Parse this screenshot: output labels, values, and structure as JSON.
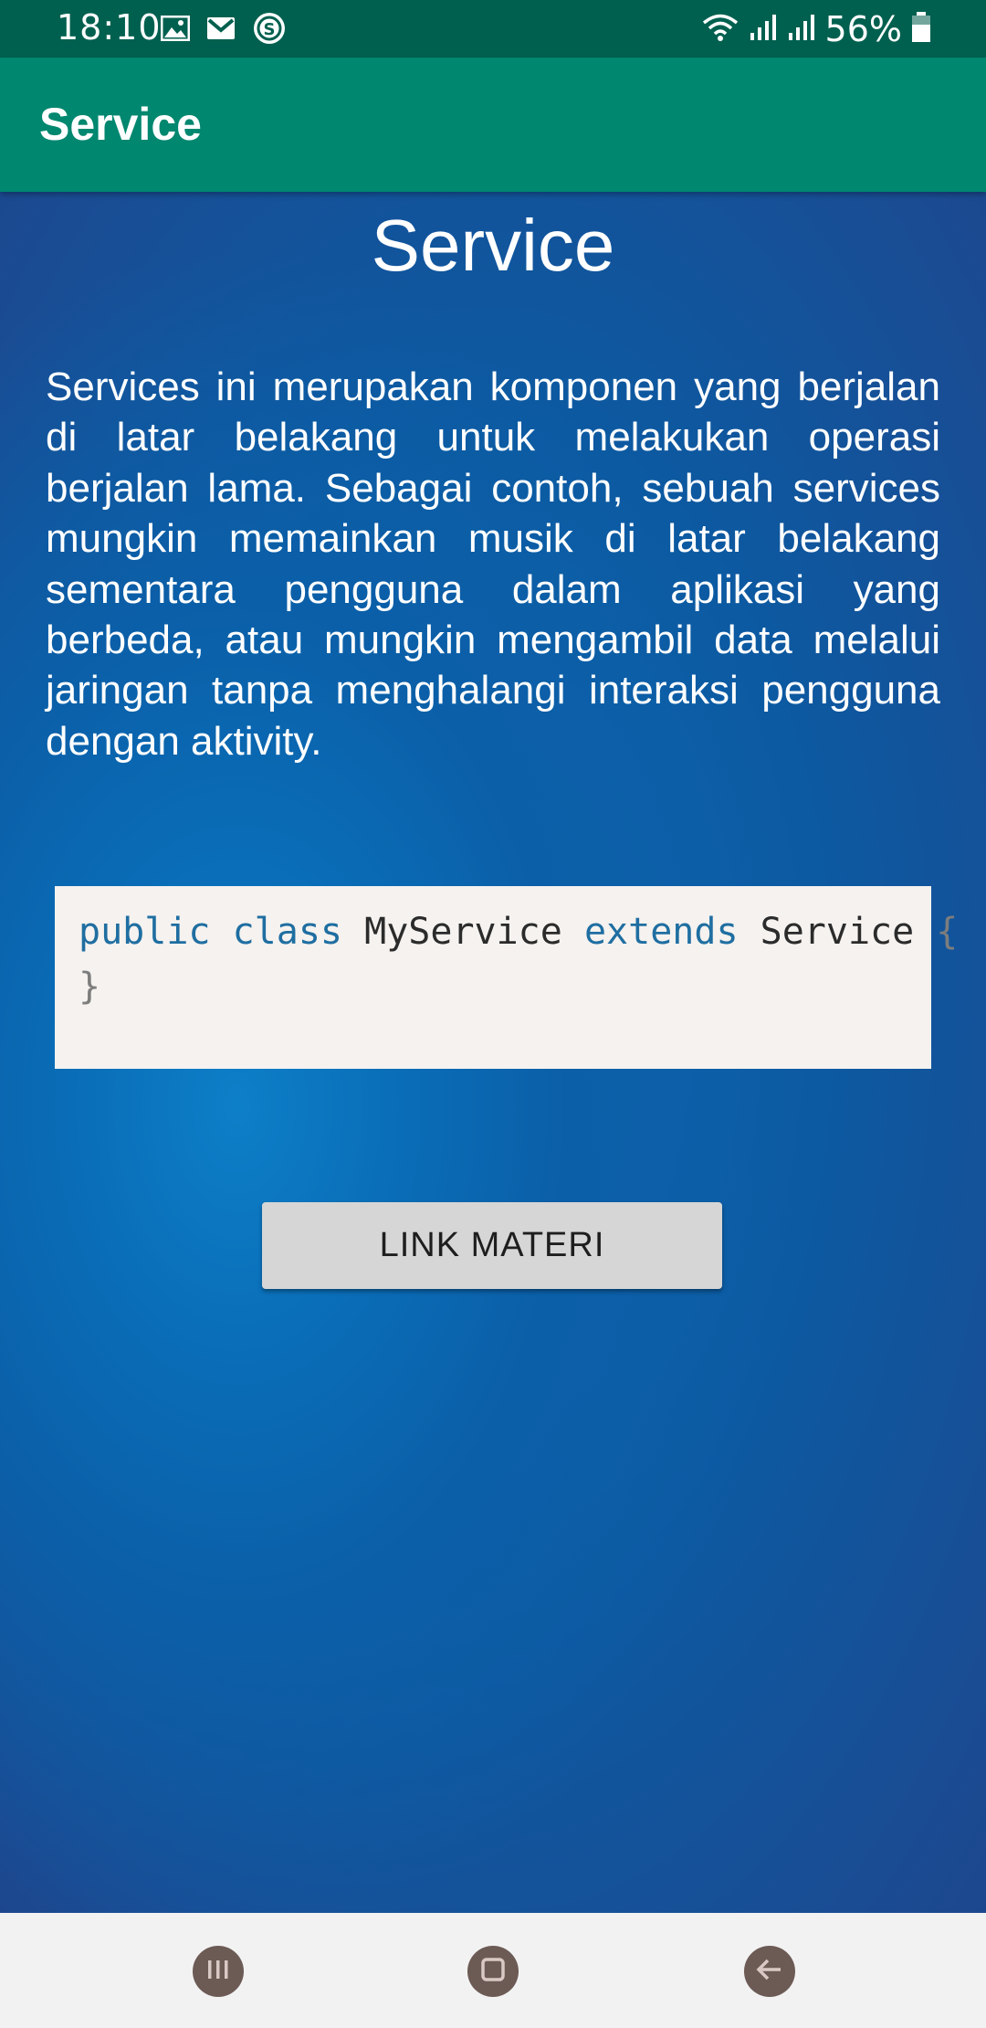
{
  "status_bar": {
    "time": "18:10",
    "battery": "56%",
    "left_icons": [
      "image-icon",
      "gmail-icon",
      "s-app-icon"
    ],
    "right_icons": [
      "wifi-icon",
      "signal-icon",
      "signal-icon",
      "battery-icon"
    ]
  },
  "app_bar": {
    "title": "Service",
    "color": "#00876f"
  },
  "content": {
    "heading": "Service",
    "paragraph": "Services ini merupakan komponen yang berjalan di latar belakang untuk melakukan operasi berjalan lama. Sebagai contoh, sebuah services mungkin memainkan musik di latar belakang sementara pengguna dalam aplikasi yang berbeda, atau mungkin mengambil data melalui jaringan tanpa menghalangi interaksi pengguna dengan aktivity.",
    "code": {
      "kw_public": "public",
      "kw_class": "class",
      "class_name": "MyService",
      "kw_extends": "extends",
      "parent_class": "Service",
      "open_brace": "{",
      "close_brace": "}"
    },
    "button_label": "LINK MATERI"
  },
  "nav_bar": {
    "buttons": [
      "recent-apps-icon",
      "home-icon",
      "back-icon"
    ]
  }
}
